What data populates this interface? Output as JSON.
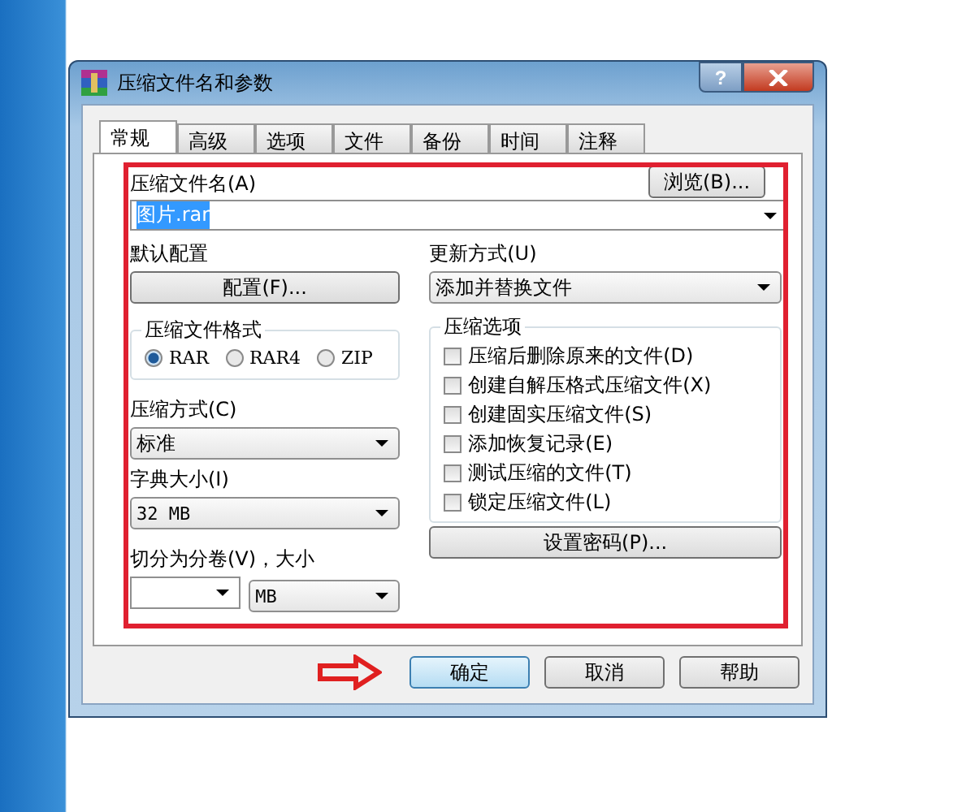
{
  "window": {
    "title": "压缩文件名和参数",
    "help_button": "?"
  },
  "tabs": [
    {
      "label": "常规",
      "selected": true
    },
    {
      "label": "高级",
      "selected": false
    },
    {
      "label": "选项",
      "selected": false
    },
    {
      "label": "文件",
      "selected": false
    },
    {
      "label": "备份",
      "selected": false
    },
    {
      "label": "时间",
      "selected": false
    },
    {
      "label": "注释",
      "selected": false
    }
  ],
  "archive_name": {
    "label": "压缩文件名(A)",
    "value": "图片.rar",
    "text_selected": true,
    "browse_button": "浏览(B)..."
  },
  "profile": {
    "label": "默认配置",
    "button": "配置(F)..."
  },
  "update_mode": {
    "label": "更新方式(U)",
    "value": "添加并替换文件"
  },
  "format": {
    "label": "压缩文件格式",
    "options": [
      {
        "label": "RAR",
        "selected": true
      },
      {
        "label": "RAR4",
        "selected": false
      },
      {
        "label": "ZIP",
        "selected": false
      }
    ]
  },
  "method": {
    "label": "压缩方式(C)",
    "value": "标准"
  },
  "dictionary": {
    "label": "字典大小(I)",
    "value": "32 MB"
  },
  "split": {
    "label": "切分为分卷(V)，大小",
    "unit": "MB"
  },
  "options": {
    "label": "压缩选项",
    "items": [
      {
        "label": "压缩后删除原来的文件(D)",
        "checked": false
      },
      {
        "label": "创建自解压格式压缩文件(X)",
        "checked": false
      },
      {
        "label": "创建固实压缩文件(S)",
        "checked": false
      },
      {
        "label": "添加恢复记录(E)",
        "checked": false
      },
      {
        "label": "测试压缩的文件(T)",
        "checked": false
      },
      {
        "label": "锁定压缩文件(L)",
        "checked": false
      }
    ]
  },
  "password_button": "设置密码(P)...",
  "buttons": [
    {
      "label": "确定",
      "default": true
    },
    {
      "label": "取消",
      "default": false
    },
    {
      "label": "帮助",
      "default": false
    }
  ]
}
